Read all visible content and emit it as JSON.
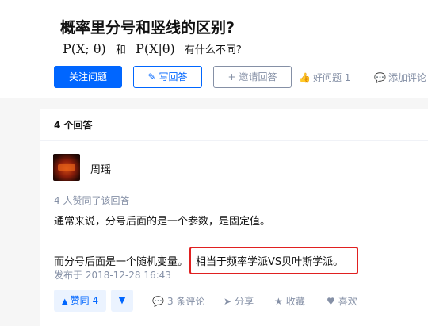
{
  "question": {
    "title": "概率里分号和竖线的区别?",
    "subtitle": {
      "math_a": "P(X; θ)",
      "and": "和",
      "math_b": "P(X|θ)",
      "tail": "有什么不同?"
    },
    "buttons": {
      "follow": "关注问题",
      "write": "写回答",
      "invite": "邀请回答",
      "good_question": "好问题 1",
      "add_comment": "添加评论"
    }
  },
  "answers": {
    "count_label": "4 个回答",
    "answer": {
      "author": "周瑶",
      "votes_label": "4 人赞同了该回答",
      "paragraph1": "通常来说，分号后面的是一个参数，是固定值。",
      "paragraph2_lead": "而分号后面是一个随机变量。",
      "paragraph2_highlight": "相当于频率学派VS贝叶斯学派。",
      "posted": "发布于 2018-12-28 16:43",
      "actions": {
        "upvote": "赞同 4",
        "comments": "3 条评论",
        "share": "分享",
        "favorite": "收藏",
        "like": "喜欢"
      }
    }
  },
  "icons": {
    "up_triangle": "▲",
    "down_triangle": "▼",
    "pencil": "✎",
    "add_user": "+",
    "thumbs_up": "👍",
    "comment": "💬",
    "share": "➤",
    "star": "★",
    "heart": "♥"
  },
  "colors": {
    "accent": "#0066ff",
    "muted": "#8590a6",
    "highlight_border": "#e02020"
  }
}
